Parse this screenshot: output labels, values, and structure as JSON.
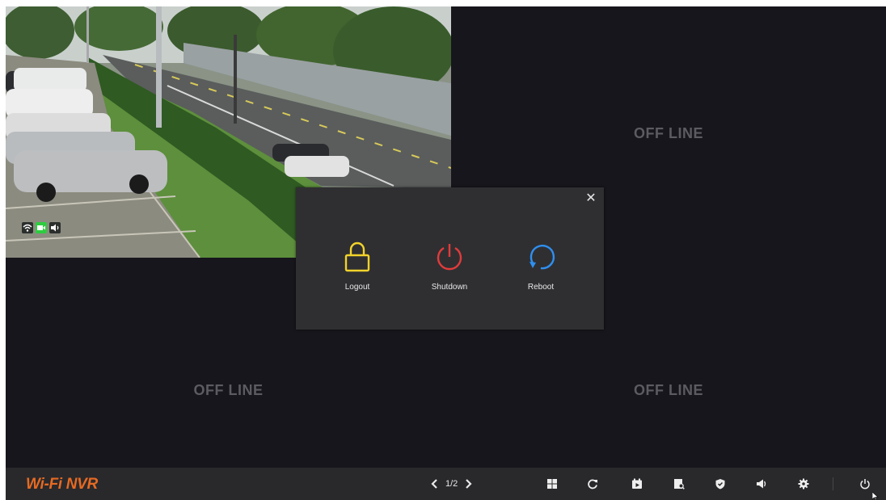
{
  "channels": {
    "ch2_status": "OFF LINE",
    "ch3_status": "OFF LINE",
    "ch4_status": "OFF LINE"
  },
  "camera_status_icons": [
    "wifi-icon",
    "record-icon",
    "audio-icon"
  ],
  "power_dialog": {
    "logout_label": "Logout",
    "shutdown_label": "Shutdown",
    "reboot_label": "Reboot",
    "close_glyph": "✕",
    "colors": {
      "logout": "#f2d32a",
      "shutdown": "#e23b3b",
      "reboot": "#2f8ff0"
    }
  },
  "taskbar": {
    "logo_text": "Wi-Fi NVR",
    "page_indicator": "1/2",
    "icons": [
      "split-screen-icon",
      "refresh-icon",
      "playback-icon",
      "search-icon",
      "shield-icon",
      "broadcast-icon",
      "settings-icon",
      "power-icon"
    ]
  },
  "colors": {
    "brand_orange": "#e66a22",
    "offline_text": "#5c5b62",
    "background": "#17161c",
    "taskbar": "#29292c"
  }
}
